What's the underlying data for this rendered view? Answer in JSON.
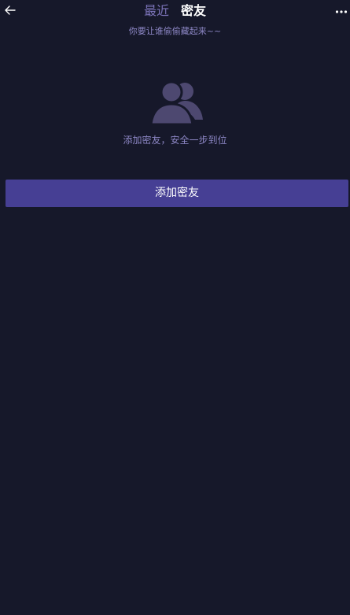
{
  "header": {
    "tabs": [
      {
        "label": "最近",
        "active": false
      },
      {
        "label": "密友",
        "active": true
      }
    ],
    "subtitle": "你要让谁偷偷藏起来~~",
    "icons": {
      "back": "back-arrow-icon",
      "more": "more-icon"
    }
  },
  "empty_state": {
    "icon": "people-icon",
    "message": "添加密友，安全一步到位"
  },
  "actions": {
    "add_button_label": "添加密友"
  },
  "colors": {
    "background": "#16182a",
    "accent": "#463f94",
    "inactive_tab": "#7b73b8",
    "muted_text": "#8c86c4",
    "icon_fill": "#4d4870"
  }
}
